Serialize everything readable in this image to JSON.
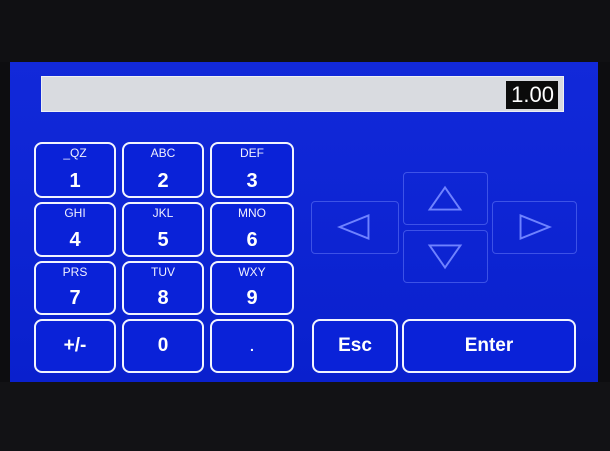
{
  "display": {
    "value": "1.00"
  },
  "keypad": {
    "k1": {
      "letters": "_QZ",
      "digit": "1"
    },
    "k2": {
      "letters": "ABC",
      "digit": "2"
    },
    "k3": {
      "letters": "DEF",
      "digit": "3"
    },
    "k4": {
      "letters": "GHI",
      "digit": "4"
    },
    "k5": {
      "letters": "JKL",
      "digit": "5"
    },
    "k6": {
      "letters": "MNO",
      "digit": "6"
    },
    "k7": {
      "letters": "PRS",
      "digit": "7"
    },
    "k8": {
      "letters": "TUV",
      "digit": "8"
    },
    "k9": {
      "letters": "WXY",
      "digit": "9"
    },
    "sign": "+/-",
    "zero": "0",
    "decimal": "."
  },
  "actions": {
    "esc": "Esc",
    "enter": "Enter"
  },
  "arrows": [
    "arrow-left-icon",
    "arrow-up-icon",
    "arrow-down-icon",
    "arrow-right-icon"
  ],
  "colors": {
    "screen": "#0a22d8",
    "key_border": "#f2f4ff",
    "display_bg": "#d9dbe0"
  }
}
